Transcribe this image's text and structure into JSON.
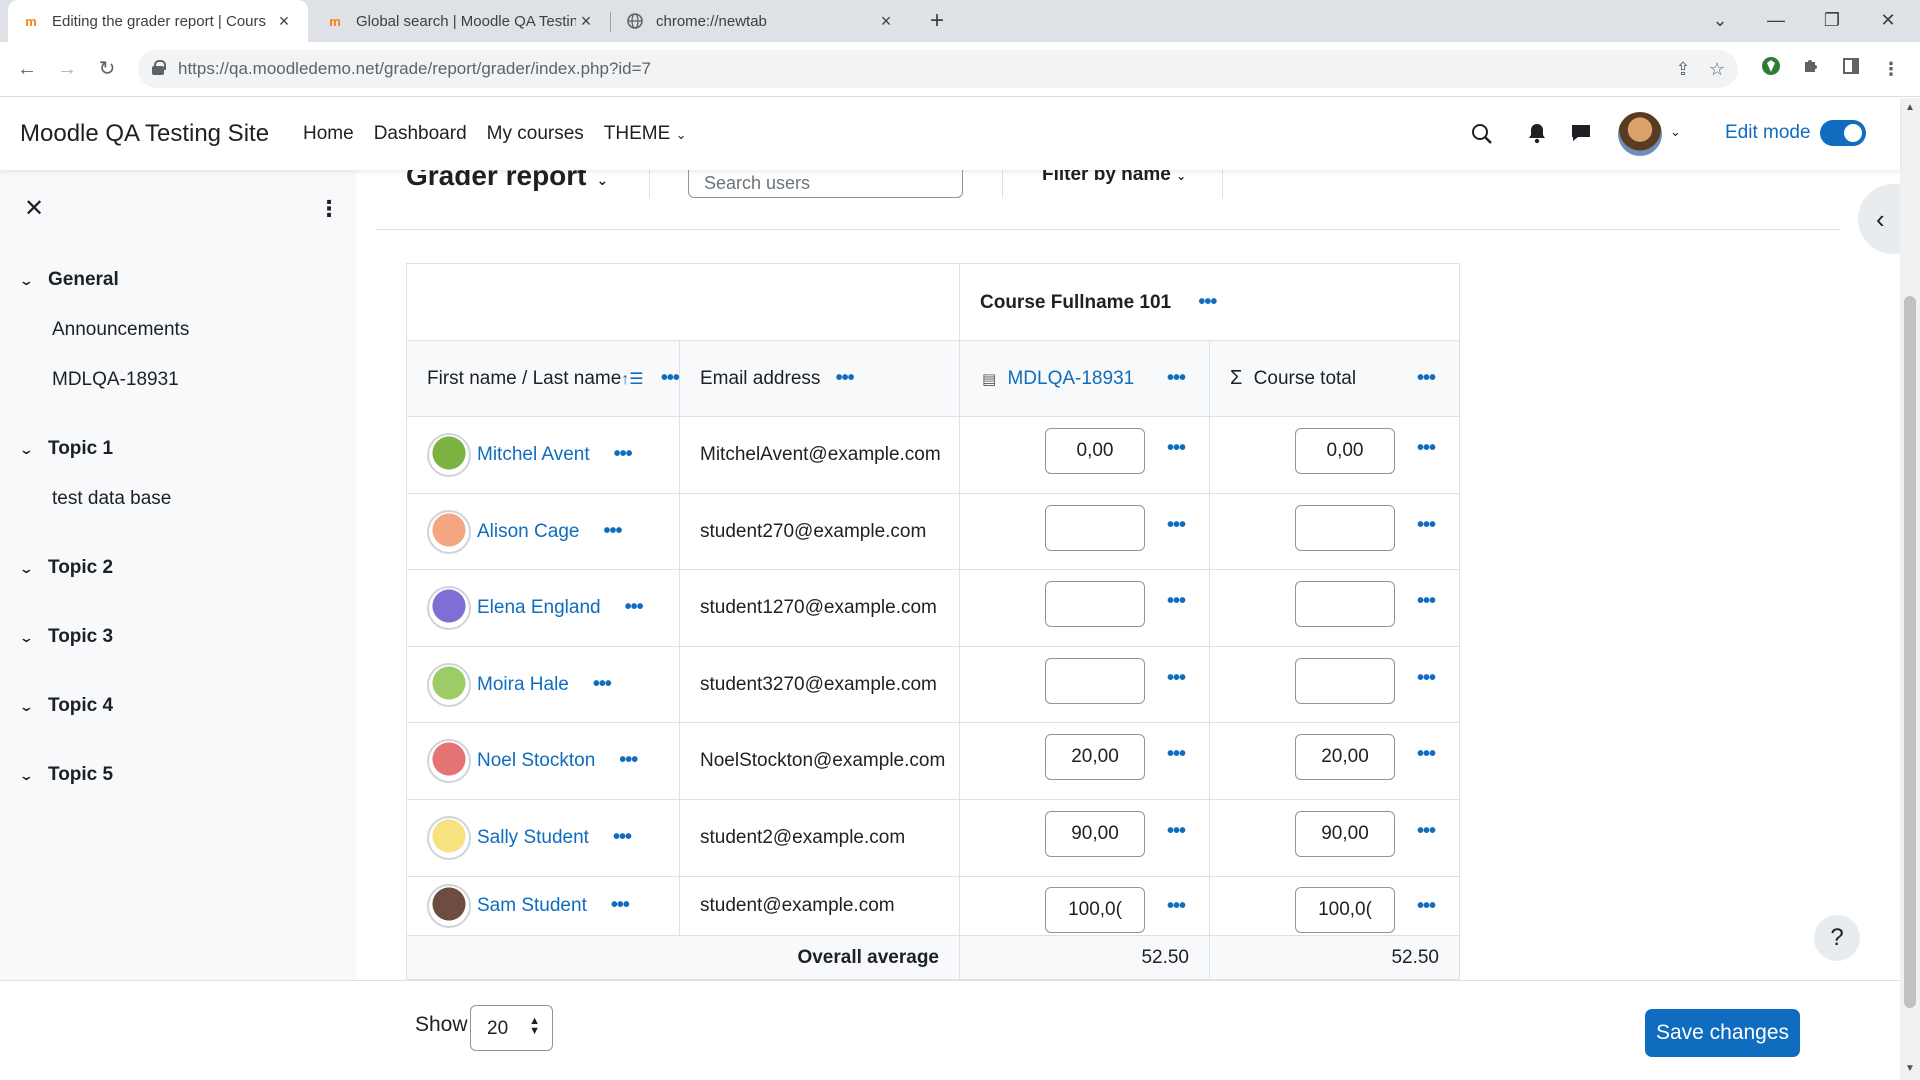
{
  "browser": {
    "tabs": [
      {
        "title": "Editing the grader report | Cours",
        "active": true,
        "favicon": "moodle-icon"
      },
      {
        "title": "Global search | Moodle QA Testin",
        "active": false,
        "favicon": "moodle-icon"
      },
      {
        "title": "chrome://newtab",
        "active": false,
        "favicon": "globe-icon"
      }
    ],
    "url_host": "https://qa.moodledemo.net",
    "url_path": "/grade/report/grader/index.php?id=7"
  },
  "navbar": {
    "site_name": "Moodle QA Testing Site",
    "links": [
      "Home",
      "Dashboard",
      "My courses",
      "THEME"
    ],
    "edit_mode": "Edit mode",
    "edit_mode_on": true
  },
  "drawer": {
    "sections": [
      {
        "title": "General",
        "items": [
          "Announcements",
          "MDLQA-18931"
        ]
      },
      {
        "title": "Topic 1",
        "items": [
          "test data base"
        ]
      },
      {
        "title": "Topic 2",
        "items": []
      },
      {
        "title": "Topic 3",
        "items": []
      },
      {
        "title": "Topic 4",
        "items": []
      },
      {
        "title": "Topic 5",
        "items": []
      }
    ]
  },
  "main": {
    "title": "Grader report",
    "search_placeholder": "Search users",
    "filter_label": "Filter by name"
  },
  "table": {
    "course_header": "Course Fullname 101",
    "col_name": "First name / Last name",
    "col_email": "Email address",
    "col_item": "MDLQA-18931",
    "col_total": "Course total",
    "rows": [
      {
        "name": "Mitchel Avent",
        "email": "MitchelAvent@example.com",
        "grade": "0,00",
        "total": "0,00",
        "avatar_color": "#7cb342"
      },
      {
        "name": "Alison Cage",
        "email": "student270@example.com",
        "grade": "",
        "total": "",
        "avatar_color": "#f4a582"
      },
      {
        "name": "Elena England",
        "email": "student1270@example.com",
        "grade": "",
        "total": "",
        "avatar_color": "#7e6fd6"
      },
      {
        "name": "Moira Hale",
        "email": "student3270@example.com",
        "grade": "",
        "total": "",
        "avatar_color": "#9ccc65"
      },
      {
        "name": "Noel Stockton",
        "email": "NoelStockton@example.com",
        "grade": "20,00",
        "total": "20,00",
        "avatar_color": "#e57373"
      },
      {
        "name": "Sally Student",
        "email": "student2@example.com",
        "grade": "90,00",
        "total": "90,00",
        "avatar_color": "#f6e27f"
      },
      {
        "name": "Sam Student",
        "email": "student@example.com",
        "grade": "100,0(",
        "total": "100,0(",
        "avatar_color": "#6d4c41"
      }
    ],
    "overall_label": "Overall average",
    "overall_item": "52.50",
    "overall_total": "52.50"
  },
  "footer": {
    "show_label": "Show",
    "show_value": "20",
    "save_label": "Save changes",
    "help_label": "?"
  },
  "colors": {
    "accent": "#0f6cbf",
    "drawer_bg": "#f8f9fa"
  }
}
